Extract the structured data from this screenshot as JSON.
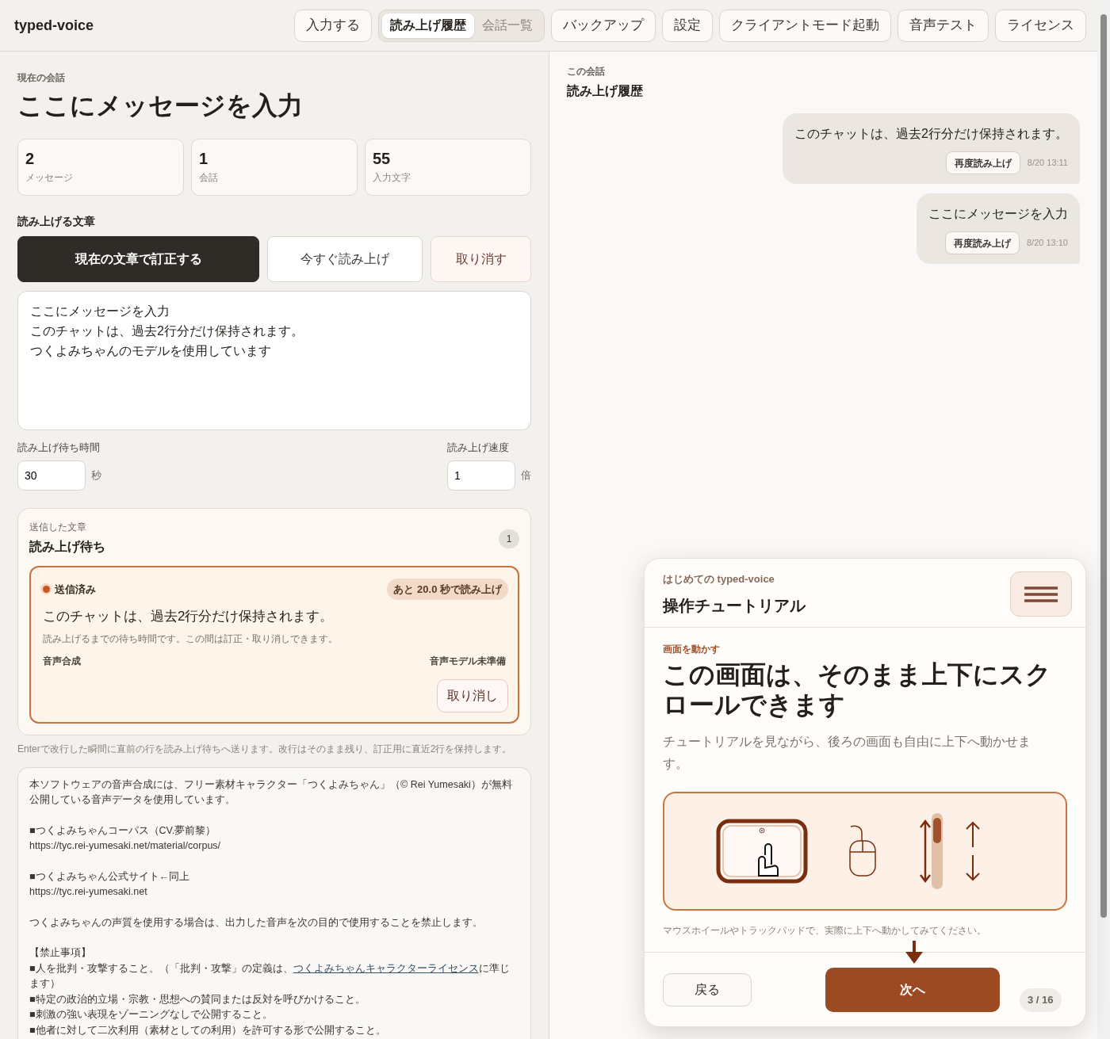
{
  "app": {
    "title": "typed-voice"
  },
  "nav": [
    {
      "kind": "button",
      "label": "入力する"
    },
    {
      "kind": "segment",
      "options": [
        {
          "label": "読み上げ履歴",
          "selected": true
        },
        {
          "label": "会話一覧",
          "selected": false
        }
      ]
    },
    {
      "kind": "button",
      "label": "バックアップ"
    },
    {
      "kind": "button",
      "label": "設定"
    },
    {
      "kind": "button",
      "label": "クライアントモード起動"
    },
    {
      "kind": "button",
      "label": "音声テスト"
    },
    {
      "kind": "button",
      "label": "ライセンス"
    }
  ],
  "current": {
    "eyebrow": "現在の会話",
    "title": "ここにメッセージを入力"
  },
  "stats": [
    {
      "value": "2",
      "label": "メッセージ"
    },
    {
      "value": "1",
      "label": "会話"
    },
    {
      "value": "55",
      "label": "入力文字"
    }
  ],
  "editor": {
    "label": "読み上げる文章",
    "actions": [
      {
        "kind": "primary",
        "label": "現在の文章で訂正する"
      },
      {
        "kind": "secondary",
        "label": "今すぐ読み上げ"
      },
      {
        "kind": "danger",
        "label": "取り消す"
      }
    ],
    "lines": [
      "ここにメッセージを入力",
      "このチャットは、過去2行分だけ保持されます。",
      "つくよみちゃんのモデルを使用しています"
    ],
    "wait": {
      "label": "読み上げ待ち時間",
      "value": "30",
      "unit": "秒"
    },
    "speed": {
      "label": "読み上げ速度",
      "value": "1",
      "unit": "倍"
    }
  },
  "queue": {
    "eyebrow": "送信した文章",
    "title": "読み上げ待ち",
    "count": "1",
    "items": [
      {
        "status": "送信済み",
        "countdown": "あと 20.0 秒で読み上げ",
        "text": "このチャットは、過去2行分だけ保持されます。",
        "note": "読み上げるまでの待ち時間です。この間は訂正・取り消しできます。",
        "engine": "音声合成",
        "engine_status": "音声モデル未準備",
        "cancel": "取り消し"
      }
    ]
  },
  "hint": "Enterで改行した瞬間に直前の行を読み上げ待ちへ送ります。改行はそのまま残り、訂正用に直近2行を保持します。",
  "license": [
    {
      "text": "本ソフトウェアの音声合成には、フリー素材キャラクター「つくよみちゃん」（© Rei Yumesaki）が無料公開している音声データを使用しています。"
    },
    {
      "text": "■つくよみちゃんコーパス（CV.夢前黎）\nhttps://tyc.rei-yumesaki.net/material/corpus/"
    },
    {
      "text": "■つくよみちゃん公式サイト←同上\nhttps://tyc.rei-yumesaki.net"
    },
    {
      "text": "つくよみちゃんの声質を使用する場合は、出力した音声を次の目的で使用することを禁止します。"
    },
    {
      "text": "【禁止事項】\n■人を批判・攻撃すること。（「批判・攻撃」の定義は、",
      "link": "つくよみちゃんキャラクターライセンス",
      "after": "に準じます）\n■特定の政治的立場・宗教・思想への賛同または反対を呼びかけること。\n■刺激の強い表現をゾーニングなしで公開すること。\n■他者に対して二次利用（素材としての利用）を許可する形で公開すること。"
    }
  ],
  "history": {
    "eyebrow": "この会話",
    "title": "読み上げ履歴",
    "messages": [
      {
        "text": "このチャットは、過去2行分だけ保持されます。",
        "action": "再度読み上げ",
        "time": "8/20 13:11"
      },
      {
        "text": "ここにメッセージを入力",
        "action": "再度読み上げ",
        "time": "8/20 13:10"
      }
    ]
  },
  "tutorial": {
    "eyebrow": "はじめての typed-voice",
    "title": "操作チュートリアル",
    "step_label": "画面を動かす",
    "heading": "この画面は、そのまま上下にスクロールできます",
    "body": "チュートリアルを見ながら、後ろの画面も自由に上下へ動かせます。",
    "caption": "マウスホイールやトラックパッドで、実際に上下へ動かしてみてください。",
    "back": "戻る",
    "next": "次へ",
    "progress": "3 / 16"
  }
}
